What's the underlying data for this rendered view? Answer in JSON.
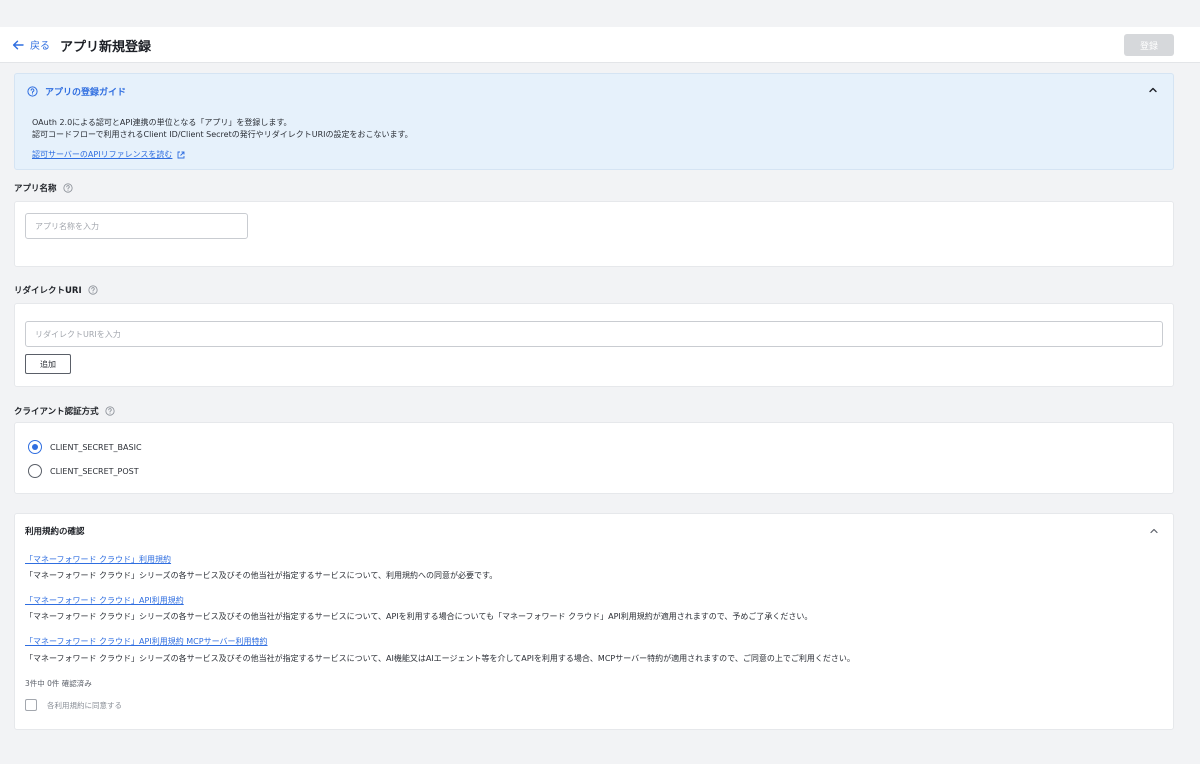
{
  "header": {
    "back_label": "戻る",
    "title": "アプリ新規登録",
    "register_label": "登録"
  },
  "guide": {
    "title": "アプリの登録ガイド",
    "line1": "OAuth 2.0による認可とAPI連携の単位となる「アプリ」を登録します。",
    "line2": "認可コードフローで利用されるClient ID/Client Secretの発行やリダイレクトURIの設定をおこないます。",
    "link": "認可サーバーのAPIリファレンスを読む"
  },
  "app_name": {
    "label": "アプリ名称",
    "placeholder": "アプリ名称を入力",
    "value": ""
  },
  "redirect_uri": {
    "label": "リダイレクトURI",
    "placeholder": "リダイレクトURIを入力",
    "value": "",
    "add_label": "追加"
  },
  "client_auth": {
    "label": "クライアント認証方式",
    "options": [
      "CLIENT_SECRET_BASIC",
      "CLIENT_SECRET_POST"
    ],
    "selected": "CLIENT_SECRET_BASIC"
  },
  "terms": {
    "title": "利用規約の確認",
    "items": [
      {
        "link": "「マネーフォワード クラウド」利用規約",
        "desc": "「マネーフォワード クラウド」シリーズの各サービス及びその他当社が指定するサービスについて、利用規約への同意が必要です。"
      },
      {
        "link": "「マネーフォワード クラウド」API利用規約",
        "desc": "「マネーフォワード クラウド」シリーズの各サービス及びその他当社が指定するサービスについて、APIを利用する場合についても「マネーフォワード クラウド」API利用規約が適用されますので、予めご了承ください。"
      },
      {
        "link": "「マネーフォワード クラウド」API利用規約 MCPサーバー利用特約",
        "desc": "「マネーフォワード クラウド」シリーズの各サービス及びその他当社が指定するサービスについて、AI機能又はAIエージェント等を介してAPIを利用する場合、MCPサーバー特約が適用されますので、ご同意の上でご利用ください。"
      }
    ],
    "confirm_count": "3件中 0件 確認済み",
    "agree_label": "各利用規約に同意する"
  },
  "colors": {
    "accent": "#2f6ee0",
    "guide_bg": "#e6f1fb",
    "page_bg": "#f2f3f5",
    "disabled_button": "#d6d8db"
  },
  "icons": {
    "back": "arrow-left-icon",
    "help": "question-circle-icon",
    "collapse": "chevron-up-icon",
    "external": "external-link-icon"
  }
}
